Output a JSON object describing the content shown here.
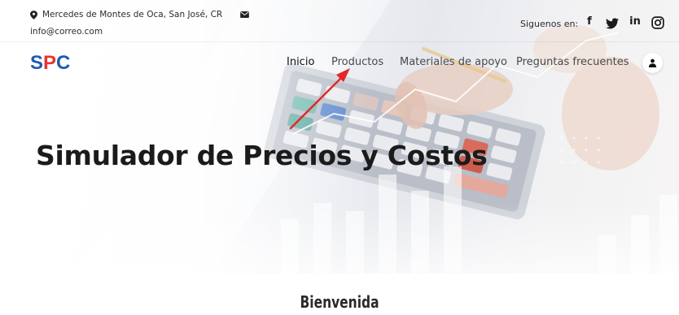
{
  "topbar": {
    "address": "Mercedes de Montes de Oca, San José, CR",
    "email": "info@correo.com",
    "social_label": "Siguenos en:",
    "social_icons": [
      "facebook-icon",
      "twitter-icon",
      "linkedin-icon",
      "instagram-icon"
    ]
  },
  "logo": {
    "s": "S",
    "p": "P",
    "c": "C"
  },
  "nav": {
    "items": [
      {
        "label": "Inicio"
      },
      {
        "label": "Productos"
      },
      {
        "label": "Materiales de apoyo"
      },
      {
        "label": "Preguntas frecuentes"
      }
    ]
  },
  "hero": {
    "title": "Simulador de Precios y Costos"
  },
  "section": {
    "title": "Bienvenida"
  },
  "colors": {
    "brand_blue": "#1f5bb5",
    "brand_red": "#e6352b",
    "annotation_red": "#e32626"
  }
}
